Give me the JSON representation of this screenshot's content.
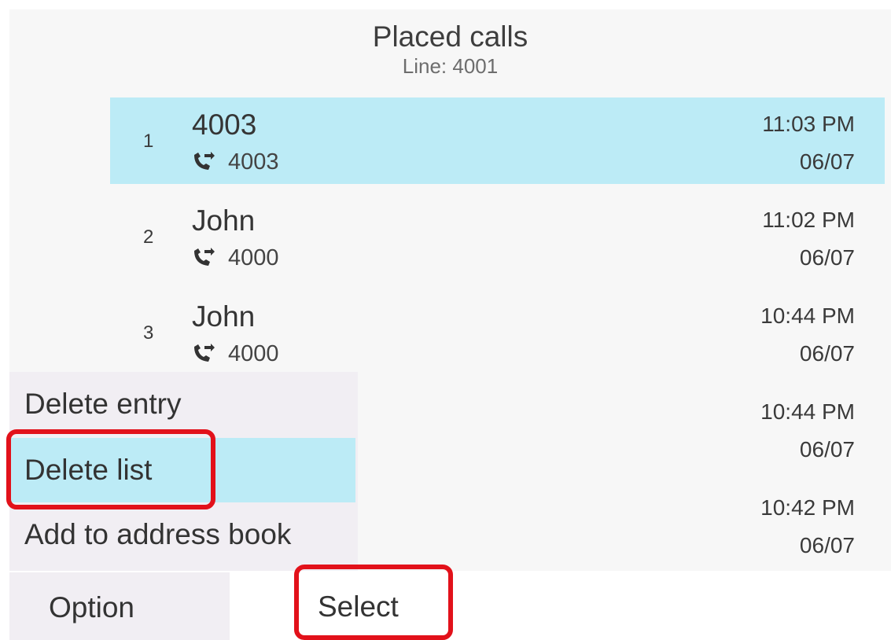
{
  "header": {
    "title": "Placed calls",
    "line": "Line: 4001"
  },
  "calls": [
    {
      "index": "1",
      "name": "4003",
      "number": "4003",
      "time": "11:03 PM",
      "date": "06/07",
      "selected": true,
      "icon": "outgoing-call-icon"
    },
    {
      "index": "2",
      "name": "John",
      "number": "4000",
      "time": "11:02 PM",
      "date": "06/07",
      "selected": false,
      "icon": "outgoing-call-icon"
    },
    {
      "index": "3",
      "name": "John",
      "number": "4000",
      "time": "10:44 PM",
      "date": "06/07",
      "selected": false,
      "icon": "outgoing-call-icon"
    },
    {
      "time": "10:44 PM",
      "date": "06/07"
    },
    {
      "time": "10:42 PM",
      "date": "06/07"
    }
  ],
  "menu": {
    "items": [
      {
        "label": "Delete entry",
        "selected": false
      },
      {
        "label": "Delete list",
        "selected": true
      },
      {
        "label": "Add to address book",
        "selected": false
      }
    ]
  },
  "softkeys": {
    "option": "Option",
    "select": "Select"
  },
  "colors": {
    "selection": "#bcebf6",
    "callout": "#e2111a",
    "menu_background": "#f1eef3"
  }
}
